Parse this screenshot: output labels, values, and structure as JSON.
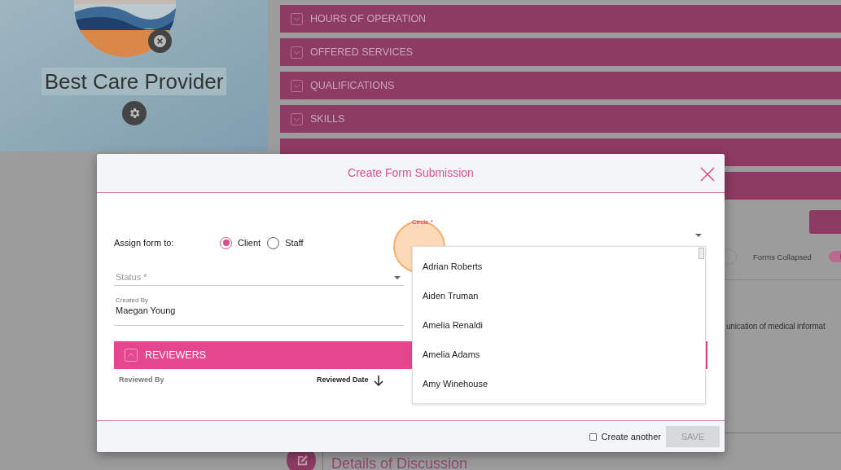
{
  "profile": {
    "name": "Best Care Provider"
  },
  "sections": [
    {
      "title": "HOURS OF OPERATION"
    },
    {
      "title": "OFFERED SERVICES"
    },
    {
      "title": "QUALIFICATIONS"
    },
    {
      "title": "SKILLS"
    }
  ],
  "background": {
    "forms_collapsed": {
      "label": "Forms Collapsed",
      "on": true
    },
    "text_fragment": "unication of medical informat",
    "details_heading": "Details of Discussion"
  },
  "modal": {
    "title": "Create Form Submission",
    "assign_label": "Assign form to:",
    "assign_options": [
      {
        "label": "Client",
        "selected": true
      },
      {
        "label": "Staff",
        "selected": false
      }
    ],
    "circle_field": {
      "label": "Circle *",
      "options": [
        "Adrian Roberts",
        "Aiden Truman",
        "Amelia Renaldi",
        "Amelia Adams",
        "Amy Winehouse"
      ]
    },
    "status_field": {
      "placeholder": "Status *"
    },
    "created_by": {
      "label": "Created By",
      "value": "Maegan Young"
    },
    "reviewers": {
      "title": "REVIEWERS",
      "expanded": true,
      "columns": [
        "Reviewed By",
        "Reviewed Date"
      ]
    },
    "create_another": {
      "label": "Create another",
      "checked": false
    },
    "save_button": {
      "label": "SAVE",
      "disabled": true
    }
  }
}
